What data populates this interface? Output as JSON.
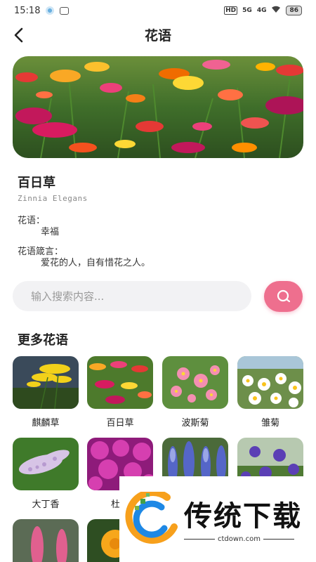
{
  "status_bar": {
    "time": "15:18",
    "network_label": "HD",
    "signal_1": "5G",
    "signal_2": "4G",
    "battery": "86"
  },
  "nav": {
    "title": "花语",
    "back_icon": "back-arrow-icon"
  },
  "flower": {
    "name": "百日草",
    "latin": "Zinnia Elegans",
    "meaning_label": "花语：",
    "meaning": "幸福",
    "motto_label": "花语箴言：",
    "motto": "爱花的人，自有惜花之人。"
  },
  "search": {
    "placeholder": "输入搜索内容..."
  },
  "more_section": {
    "title": "更多花语",
    "items": [
      {
        "label": "麒麟草"
      },
      {
        "label": "百日草"
      },
      {
        "label": "波斯菊"
      },
      {
        "label": "雏菊"
      },
      {
        "label": "大丁香"
      },
      {
        "label": "杜鹃"
      },
      {
        "label": ""
      },
      {
        "label": ""
      },
      {
        "label": ""
      },
      {
        "label": ""
      }
    ]
  },
  "watermark": {
    "brand": "传统下载",
    "url": "ctdown.com"
  },
  "colors": {
    "accent": "#ee6f8e",
    "search_bg": "#f2f2f4"
  }
}
